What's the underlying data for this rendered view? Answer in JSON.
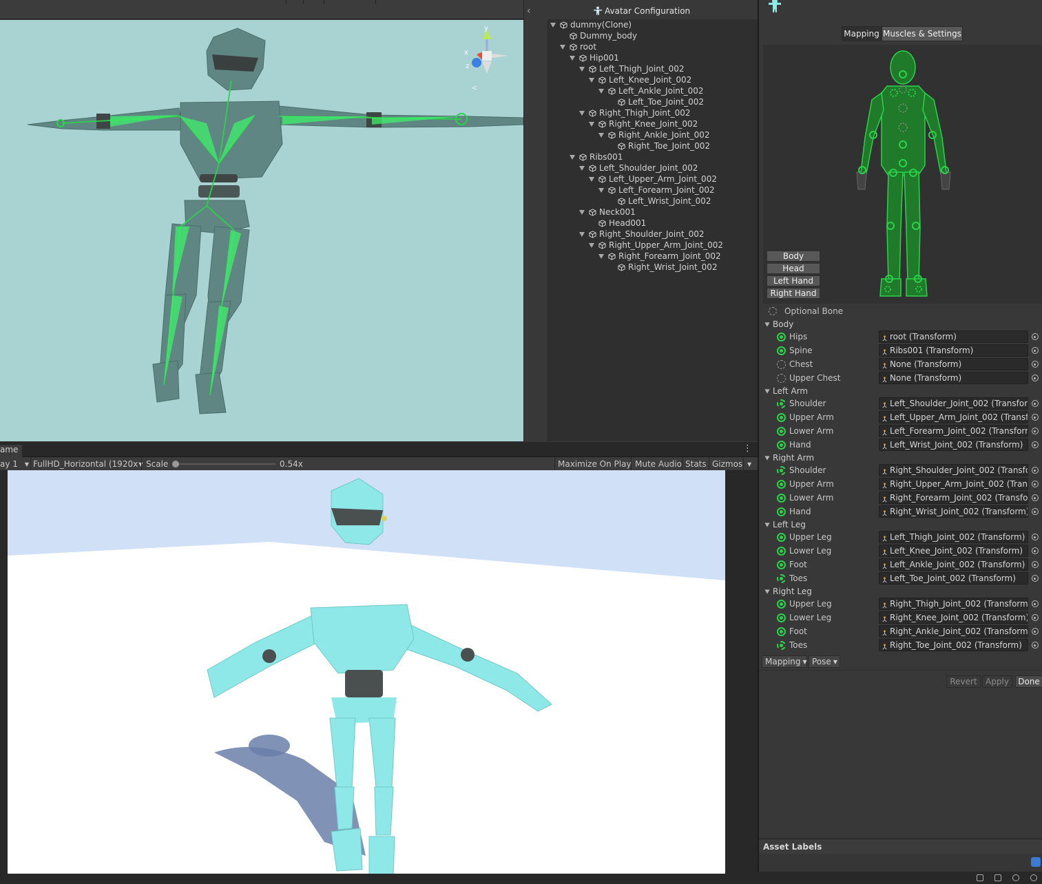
{
  "hierarchy": {
    "title": "Avatar Configuration",
    "items": [
      {
        "label": "dummy(Clone)",
        "depth": 0,
        "expanded": true
      },
      {
        "label": "Dummy_body",
        "depth": 1,
        "expanded": null
      },
      {
        "label": "root",
        "depth": 1,
        "expanded": true
      },
      {
        "label": "Hip001",
        "depth": 2,
        "expanded": true
      },
      {
        "label": "Left_Thigh_Joint_002",
        "depth": 3,
        "expanded": true
      },
      {
        "label": "Left_Knee_Joint_002",
        "depth": 4,
        "expanded": true
      },
      {
        "label": "Left_Ankle_Joint_002",
        "depth": 5,
        "expanded": true
      },
      {
        "label": "Left_Toe_Joint_002",
        "depth": 6,
        "expanded": null
      },
      {
        "label": "Right_Thigh_Joint_002",
        "depth": 3,
        "expanded": true
      },
      {
        "label": "Right_Knee_Joint_002",
        "depth": 4,
        "expanded": true
      },
      {
        "label": "Right_Ankle_Joint_002",
        "depth": 5,
        "expanded": true
      },
      {
        "label": "Right_Toe_Joint_002",
        "depth": 6,
        "expanded": null
      },
      {
        "label": "Ribs001",
        "depth": 2,
        "expanded": true
      },
      {
        "label": "Left_Shoulder_Joint_002",
        "depth": 3,
        "expanded": true
      },
      {
        "label": "Left_Upper_Arm_Joint_002",
        "depth": 4,
        "expanded": true
      },
      {
        "label": "Left_Forearm_Joint_002",
        "depth": 5,
        "expanded": true
      },
      {
        "label": "Left_Wrist_Joint_002",
        "depth": 6,
        "expanded": null
      },
      {
        "label": "Neck001",
        "depth": 3,
        "expanded": true
      },
      {
        "label": "Head001",
        "depth": 4,
        "expanded": null
      },
      {
        "label": "Right_Shoulder_Joint_002",
        "depth": 3,
        "expanded": true
      },
      {
        "label": "Right_Upper_Arm_Joint_002",
        "depth": 4,
        "expanded": true
      },
      {
        "label": "Right_Forearm_Joint_002",
        "depth": 5,
        "expanded": true
      },
      {
        "label": "Right_Wrist_Joint_002",
        "depth": 6,
        "expanded": null
      }
    ]
  },
  "game": {
    "tab_label": "ame",
    "display": "ay 1",
    "resolution": "FullHD_Horizontal (1920x",
    "scale_label": "Scale",
    "scale_value": "0.54x",
    "scale_fraction": 0.0,
    "maximize": "Maximize On Play",
    "mute": "Mute Audio",
    "stats": "Stats",
    "gizmos": "Gizmos"
  },
  "inspector": {
    "tabs": [
      "Mapping",
      "Muscles & Settings"
    ],
    "active_tab": 0,
    "body_buttons": [
      "Body",
      "Head",
      "Left Hand",
      "Right Hand"
    ],
    "optional_bone": "Optional Bone",
    "sections": [
      {
        "title": "Body",
        "bones": [
          {
            "name": "Hips",
            "value": "root (Transform)",
            "state": "mapped"
          },
          {
            "name": "Spine",
            "value": "Ribs001 (Transform)",
            "state": "mapped"
          },
          {
            "name": "Chest",
            "value": "None (Transform)",
            "state": "optional"
          },
          {
            "name": "Upper Chest",
            "value": "None (Transform)",
            "state": "optional"
          }
        ]
      },
      {
        "title": "Left Arm",
        "bones": [
          {
            "name": "Shoulder",
            "value": "Left_Shoulder_Joint_002 (Transform",
            "state": "mapped-optional"
          },
          {
            "name": "Upper Arm",
            "value": "Left_Upper_Arm_Joint_002 (Transfor",
            "state": "mapped"
          },
          {
            "name": "Lower Arm",
            "value": "Left_Forearm_Joint_002 (Transform)",
            "state": "mapped"
          },
          {
            "name": "Hand",
            "value": "Left_Wrist_Joint_002 (Transform)",
            "state": "mapped"
          }
        ]
      },
      {
        "title": "Right Arm",
        "bones": [
          {
            "name": "Shoulder",
            "value": "Right_Shoulder_Joint_002 (Transforr",
            "state": "mapped-optional"
          },
          {
            "name": "Upper Arm",
            "value": "Right_Upper_Arm_Joint_002 (Transfo",
            "state": "mapped"
          },
          {
            "name": "Lower Arm",
            "value": "Right_Forearm_Joint_002 (Transform",
            "state": "mapped"
          },
          {
            "name": "Hand",
            "value": "Right_Wrist_Joint_002 (Transform)",
            "state": "mapped"
          }
        ]
      },
      {
        "title": "Left Leg",
        "bones": [
          {
            "name": "Upper Leg",
            "value": "Left_Thigh_Joint_002 (Transform)",
            "state": "mapped"
          },
          {
            "name": "Lower Leg",
            "value": "Left_Knee_Joint_002 (Transform)",
            "state": "mapped"
          },
          {
            "name": "Foot",
            "value": "Left_Ankle_Joint_002 (Transform)",
            "state": "mapped"
          },
          {
            "name": "Toes",
            "value": "Left_Toe_Joint_002 (Transform)",
            "state": "mapped-optional"
          }
        ]
      },
      {
        "title": "Right Leg",
        "bones": [
          {
            "name": "Upper Leg",
            "value": "Right_Thigh_Joint_002 (Transform)",
            "state": "mapped"
          },
          {
            "name": "Lower Leg",
            "value": "Right_Knee_Joint_002 (Transform)",
            "state": "mapped"
          },
          {
            "name": "Foot",
            "value": "Right_Ankle_Joint_002 (Transform)",
            "state": "mapped"
          },
          {
            "name": "Toes",
            "value": "Right_Toe_Joint_002 (Transform)",
            "state": "mapped-optional"
          }
        ]
      }
    ],
    "mapping_dropdown": "Mapping",
    "pose_dropdown": "Pose",
    "revert": "Revert",
    "apply": "Apply",
    "done": "Done",
    "asset_labels": "Asset Labels"
  },
  "colors": {
    "bone_green": "#2bd34a",
    "scene_bg": "#a9d3d2",
    "game_sky": "#cfe0f7",
    "character": "#8fe8e8"
  }
}
